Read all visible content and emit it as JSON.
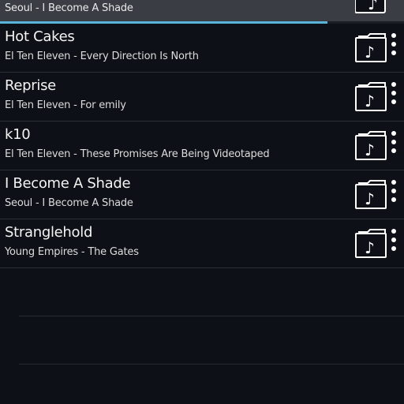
{
  "now_playing": {
    "text": "Seoul - I Become A Shade",
    "progress_fraction": 0.81
  },
  "tracks": [
    {
      "title": "Hot Cakes",
      "subtitle": "El Ten Eleven - Every Direction Is North"
    },
    {
      "title": "Reprise",
      "subtitle": "El Ten Eleven - For emily"
    },
    {
      "title": "k10",
      "subtitle": "El Ten Eleven - These Promises Are Being Videotaped"
    },
    {
      "title": "I Become A Shade",
      "subtitle": "Seoul - I Become A Shade"
    },
    {
      "title": "Stranglehold",
      "subtitle": "Young Empires - The Gates"
    }
  ],
  "icons": {
    "album": "music-folder-icon",
    "more": "more-vertical-icon"
  },
  "colors": {
    "background": "#0d1016",
    "progress": "#5ab4d9",
    "divider": "#2a2e35"
  }
}
